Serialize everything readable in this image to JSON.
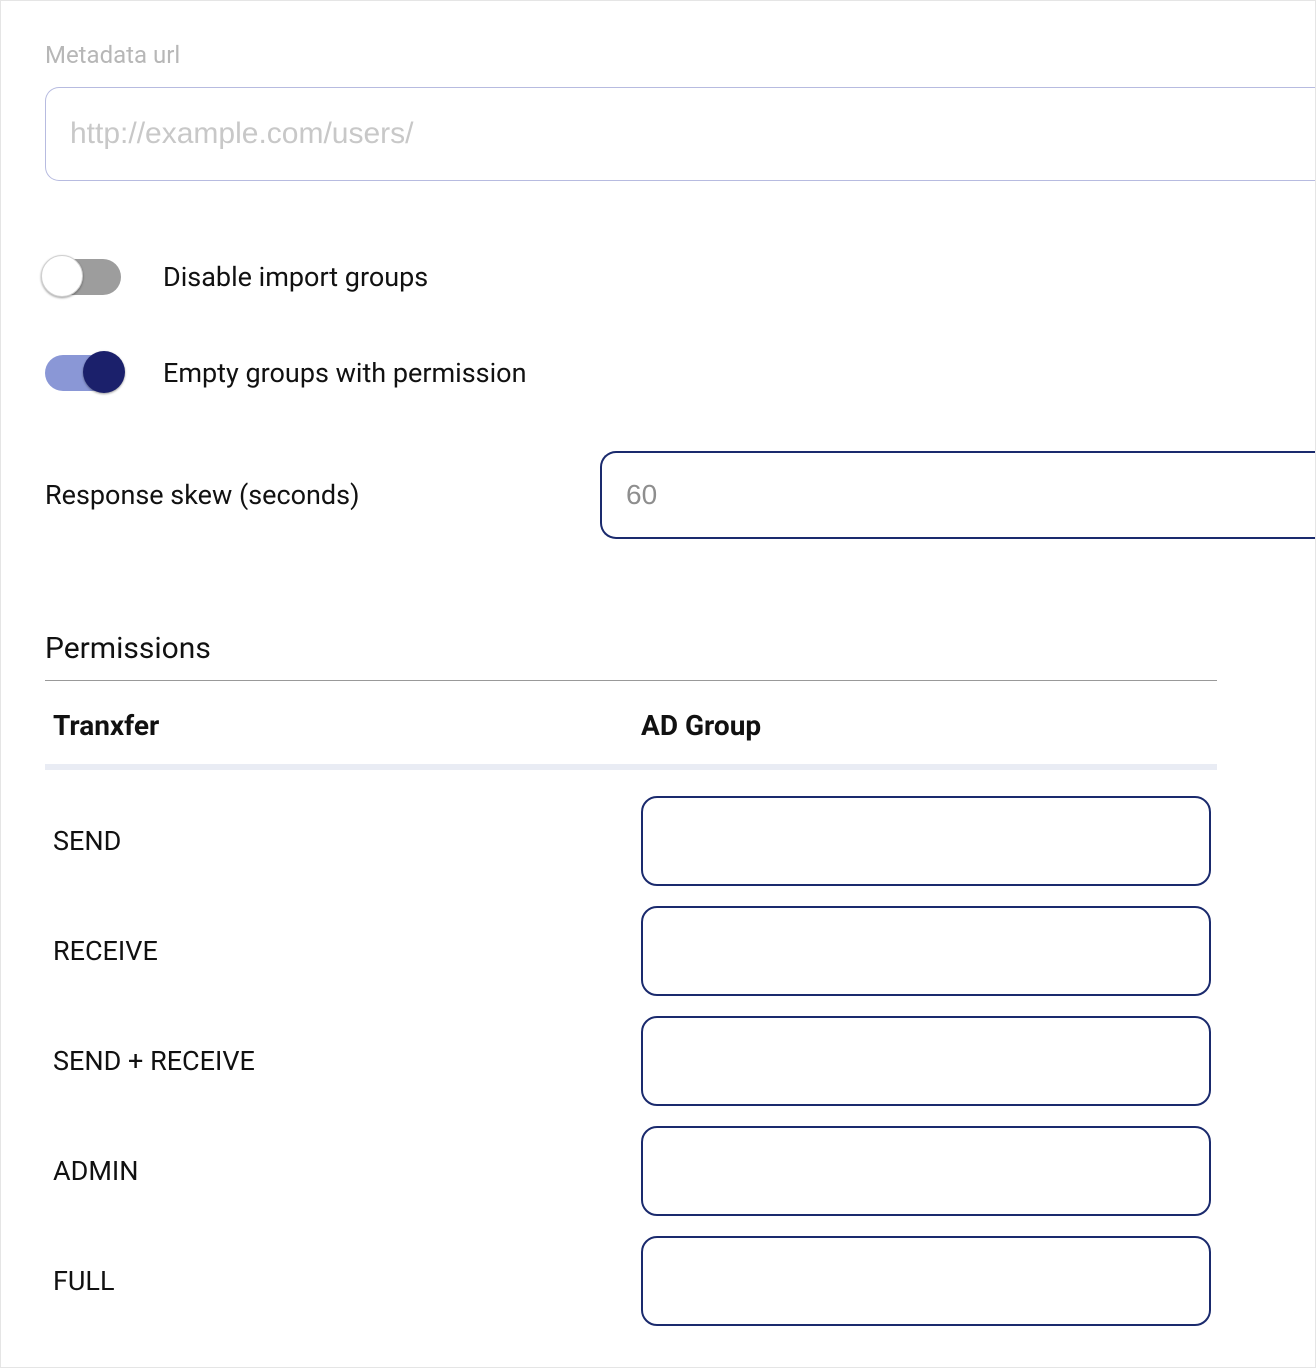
{
  "metadata": {
    "label": "Metadata url",
    "placeholder": "http://example.com/users/",
    "value": ""
  },
  "toggles": {
    "disable_import_groups": {
      "label": "Disable import groups",
      "state": "off"
    },
    "empty_groups_permission": {
      "label": "Empty groups with permission",
      "state": "on"
    }
  },
  "response_skew": {
    "label": "Response skew (seconds)",
    "placeholder": "60",
    "value": ""
  },
  "permissions": {
    "title": "Permissions",
    "columns": {
      "col1": "Tranxfer",
      "col2": "AD Group"
    },
    "rows": [
      {
        "label": "SEND",
        "value": ""
      },
      {
        "label": "RECEIVE",
        "value": ""
      },
      {
        "label": "SEND + RECEIVE",
        "value": ""
      },
      {
        "label": "ADMIN",
        "value": ""
      },
      {
        "label": "FULL",
        "value": ""
      }
    ]
  }
}
